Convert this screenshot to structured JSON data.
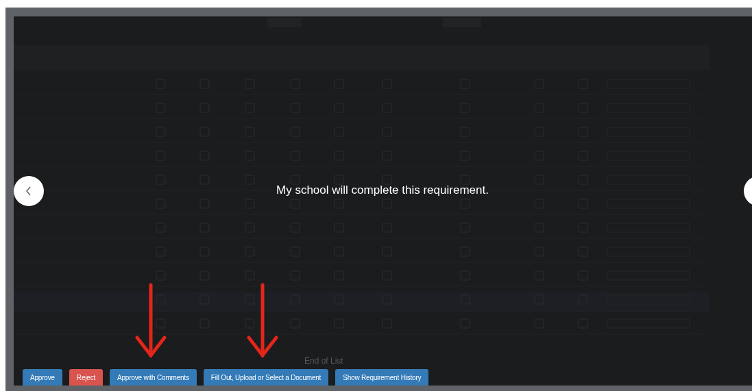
{
  "caption": "My school will complete this requirement.",
  "footer_note": "End of List",
  "buttons": [
    {
      "label": "Approve",
      "kind": "primary"
    },
    {
      "label": "Reject",
      "kind": "danger"
    },
    {
      "label": "Approve with Comments",
      "kind": "primary"
    },
    {
      "label": "Fill Out, Upload or Select a Document",
      "kind": "primary"
    },
    {
      "label": "Show Requirement History",
      "kind": "primary"
    }
  ]
}
